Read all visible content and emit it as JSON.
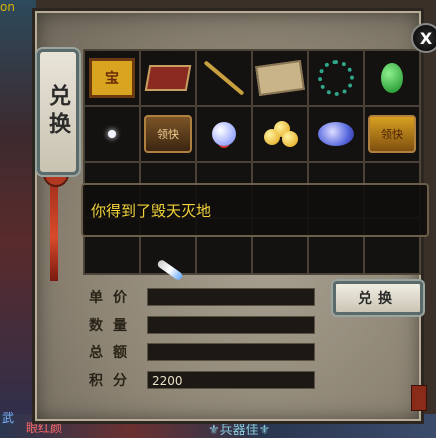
{
  "world": {
    "top_text": "on",
    "bottom_left_1": "武",
    "bottom_left_2": "眼红颜",
    "bottom_middle": "⚜兵器佳⚜"
  },
  "panel": {
    "title": "兑换",
    "close_label": "X"
  },
  "items": [
    {
      "icon": "treasure-box-icon",
      "label": "宝"
    },
    {
      "icon": "red-chest-icon",
      "label": ""
    },
    {
      "icon": "golden-staff-icon",
      "label": ""
    },
    {
      "icon": "map-scroll-icon",
      "label": ""
    },
    {
      "icon": "prayer-beads-icon",
      "label": ""
    },
    {
      "icon": "jade-stone-icon",
      "label": ""
    },
    {
      "icon": "pearl-icon",
      "label": ""
    },
    {
      "icon": "gift-case-icon",
      "label": "领快"
    },
    {
      "icon": "crystal-orb-icon",
      "label": ""
    },
    {
      "icon": "gold-balls-icon",
      "label": ""
    },
    {
      "icon": "spirit-crystal-icon",
      "label": ""
    },
    {
      "icon": "gold-gift-case-icon",
      "label": "领快"
    }
  ],
  "message": "你得到了毁天灭地",
  "fields": {
    "unit_price_label": "单价",
    "unit_price_value": "",
    "quantity_label": "数量",
    "quantity_value": "",
    "total_label": "总额",
    "total_value": "",
    "points_label": "积分",
    "points_value": "2200"
  },
  "exchange_button": "兑换",
  "colors": {
    "message_text": "#f2d33a",
    "panel_bg": "#8d8474"
  }
}
